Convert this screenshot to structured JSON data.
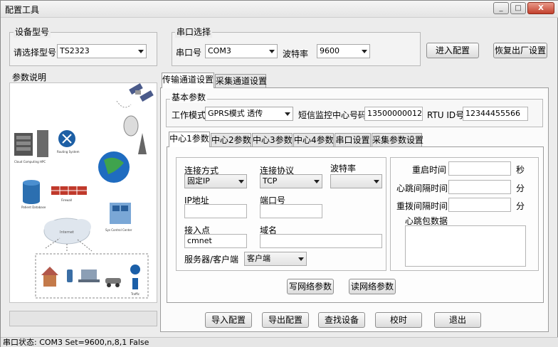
{
  "window": {
    "title": "配置工具",
    "minimize": "_",
    "maximize": "□",
    "close": "X"
  },
  "device": {
    "group_label": "设备型号",
    "select_label": "请选择型号",
    "model": "TS2323"
  },
  "serial": {
    "group_label": "串口选择",
    "port_label": "串口号",
    "port": "COM3",
    "baud_label": "波特率",
    "baud": "9600"
  },
  "top_buttons": {
    "enter_config": "进入配置",
    "factory_reset": "恢复出厂设置"
  },
  "params_desc": {
    "label": "参数说明"
  },
  "main_tabs": [
    "传输通道设置",
    "采集通道设置"
  ],
  "basic": {
    "group_label": "基本参数",
    "mode_label": "工作模式",
    "mode": "GPRS模式 透传",
    "sms_label": "短信监控中心号码",
    "sms": "13500000012",
    "rtu_label": "RTU ID号",
    "rtu": "12344455566"
  },
  "center_tabs": [
    "中心1参数",
    "中心2参数",
    "中心3参数",
    "中心4参数",
    "串口设置",
    "采集参数设置"
  ],
  "center1": {
    "conn_mode_label": "连接方式",
    "conn_mode": "固定IP",
    "protocol_label": "连接协议",
    "protocol": "TCP",
    "baud_label": "波特率",
    "baud": "",
    "ip_label": "IP地址",
    "ip": "",
    "port_label": "端口号",
    "port": "",
    "apn_label": "接入点",
    "apn": "cmnet",
    "domain_label": "域名",
    "domain": "",
    "server_client_label": "服务器/客户端",
    "server_client": "客户端"
  },
  "timing": {
    "restart_label": "重启时间",
    "restart": "",
    "restart_unit": "秒",
    "heartbeat_label": "心跳间隔时间",
    "heartbeat": "",
    "heartbeat_unit": "分",
    "redial_label": "重拨间隔时间",
    "redial": "",
    "redial_unit": "分",
    "hb_data_label": "心跳包数据",
    "hb_data": ""
  },
  "net_buttons": {
    "write": "写网络参数",
    "read": "读网络参数"
  },
  "bottom_buttons": {
    "import": "导入配置",
    "export": "导出配置",
    "find": "查找设备",
    "calibrate": "校时",
    "exit": "退出"
  },
  "status": "串口状态: COM3 Set=9600,n,8,1 False",
  "diagram": {
    "labels": [
      "Cloud Computing",
      "HPC",
      "Routing System",
      "Firewall",
      "Patient Database",
      "Sys Control Center",
      "Internet",
      "Traffic"
    ]
  }
}
